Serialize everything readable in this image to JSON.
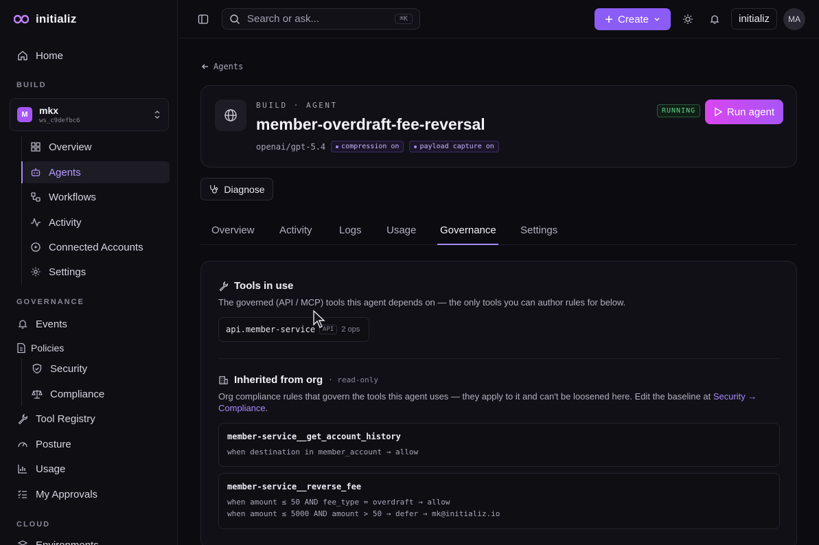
{
  "brand": {
    "name": "initializ"
  },
  "sidebar": {
    "home": "Home",
    "build_label": "BUILD",
    "workspace": {
      "avatar": "M",
      "name": "mkx",
      "id": "ws_c9defbc6"
    },
    "build_items": [
      {
        "label": "Overview",
        "icon": "grid-icon"
      },
      {
        "label": "Agents",
        "icon": "bot-icon"
      },
      {
        "label": "Workflows",
        "icon": "workflow-icon"
      },
      {
        "label": "Activity",
        "icon": "activity-icon"
      },
      {
        "label": "Connected Accounts",
        "icon": "link-circle-icon"
      },
      {
        "label": "Settings",
        "icon": "gear-icon"
      }
    ],
    "governance_label": "GOVERNANCE",
    "events": "Events",
    "policies": "Policies",
    "security": "Security",
    "compliance": "Compliance",
    "tool_registry": "Tool Registry",
    "posture": "Posture",
    "usage": "Usage",
    "my_approvals": "My Approvals",
    "cloud_label": "CLOUD",
    "environments": "Environments"
  },
  "topbar": {
    "search_placeholder": "Search or ask...",
    "search_shortcut": "⌘K",
    "create": "Create",
    "org": "initializ",
    "avatar": "MA"
  },
  "page": {
    "back": "Agents",
    "eyebrow": "BUILD · AGENT",
    "title": "member-overdraft-fee-reversal",
    "model": "openai/gpt-5.4",
    "tags": [
      "compression on",
      "payload capture on"
    ],
    "status": "RUNNING",
    "run": "Run agent",
    "diagnose": "Diagnose"
  },
  "tabs": [
    "Overview",
    "Activity",
    "Logs",
    "Usage",
    "Governance",
    "Settings"
  ],
  "active_tab": "Governance",
  "tools": {
    "title": "Tools in use",
    "desc": "The governed (API / MCP) tools this agent depends on — the only tools you can author rules for below.",
    "chip": {
      "name": "api.member-service",
      "kind": "API",
      "ops": "2 ops"
    }
  },
  "inherited": {
    "title": "Inherited from org",
    "readonly": "· read-only",
    "desc": "Org compliance rules that govern the tools this agent uses — they apply to it and can't be loosened here. Edit the baseline at ",
    "link": "Security → Compliance",
    "desc_end": ".",
    "rules": [
      {
        "name": "member-service__get_account_history",
        "lines": [
          "when destination in member_account → allow"
        ]
      },
      {
        "name": "member-service__reverse_fee",
        "lines": [
          "when amount ≤ 50 AND fee_type = overdraft → allow",
          "when amount ≤ 5000 AND amount > 50 → defer → mk@initializ.io"
        ]
      }
    ]
  }
}
